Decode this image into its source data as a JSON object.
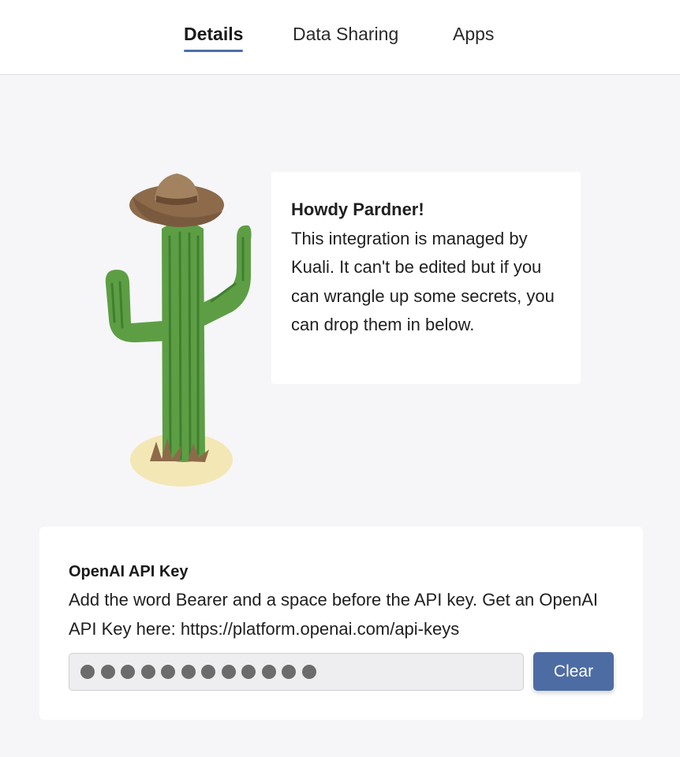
{
  "tabs": [
    {
      "label": "Details",
      "active": true
    },
    {
      "label": "Data Sharing",
      "active": false
    },
    {
      "label": "Apps",
      "active": false
    }
  ],
  "illustration": {
    "icon": "cactus-with-cowboy-hat-icon"
  },
  "bubble": {
    "title": "Howdy Pardner!",
    "body": "This integration is managed by Kuali. It can't be edited but if you can wrangle up some secrets, you can drop them in below."
  },
  "api_key": {
    "label": "OpenAI API Key",
    "description": "Add the word Bearer and a space before the API key. Get an OpenAI API Key here: https://platform.openai.com/api-keys",
    "masked_value_length": 12,
    "clear_label": "Clear"
  },
  "colors": {
    "accent": "#4d6ca4",
    "background": "#f6f6f8"
  }
}
